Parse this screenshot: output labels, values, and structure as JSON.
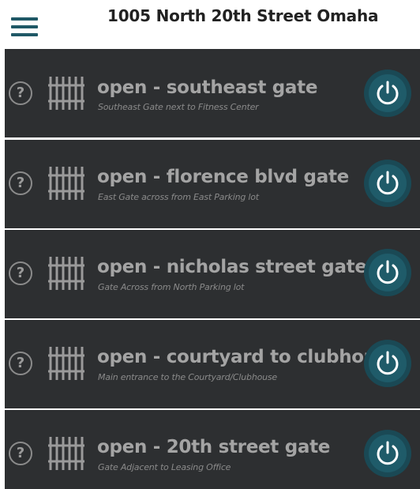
{
  "header": {
    "title": "1005 North 20th Street Omaha",
    "menu_icon": "hamburger-menu-icon"
  },
  "colors": {
    "accent": "#1f5866",
    "row_background": "#2d2f31",
    "power_button": "#1f5b69"
  },
  "gates": [
    {
      "name": "open - southeast gate",
      "description": "Southeast Gate next to Fitness Center"
    },
    {
      "name": "open - florence blvd gate",
      "description": "East Gate across from East Parking lot"
    },
    {
      "name": "open - nicholas street gate",
      "description": "Gate Across from North Parking lot"
    },
    {
      "name": "open - courtyard to clubhou",
      "description": "Main entrance to the Courtyard/Clubhouse"
    },
    {
      "name": "open - 20th street gate",
      "description": "Gate Adjacent to Leasing Office"
    }
  ],
  "row_icons": {
    "help": "?",
    "gate": "gate-icon",
    "power": "power-icon"
  }
}
